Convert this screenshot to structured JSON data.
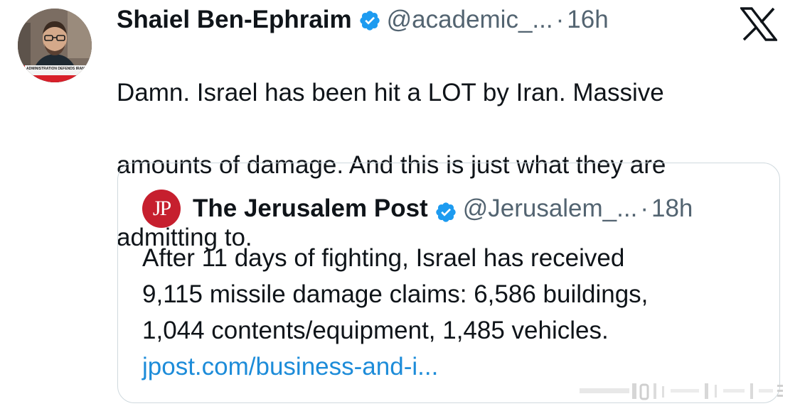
{
  "tweet": {
    "display_name": "Shaiel Ben-Ephraim",
    "handle": "@academic_...",
    "separator": "·",
    "time": "16h",
    "text_lines": [
      "Damn. Israel has been hit a LOT by Iran. Massive",
      "amounts of damage. And this is just what they are",
      "admitting to."
    ],
    "avatar_caption": "ADMINISTRATION DEFENDS IRAN"
  },
  "quote": {
    "logo_text": "JP",
    "display_name": "The Jerusalem Post",
    "handle": "@Jerusalem_...",
    "separator": "·",
    "time": "18h",
    "text_lines": [
      "After 11 days of fighting, Israel has received",
      "9,115 missile damage claims: 6,586 buildings,",
      "1,044 contents/equipment, 1,485 vehicles."
    ],
    "link": "jpost.com/business-and-i..."
  },
  "icons": {
    "brand": "x-logo",
    "verified": "verified-badge-icon",
    "logo_color": "#c61f2e",
    "verified_color": "#1d9bf0",
    "link_color": "#1d8cd9"
  }
}
